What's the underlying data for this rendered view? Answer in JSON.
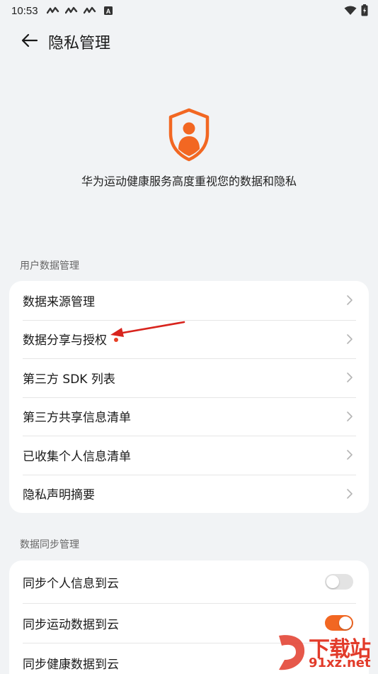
{
  "status_bar": {
    "time": "10:53",
    "icons": [
      "signal-wave-icon",
      "signal-wave-icon",
      "signal-wave-icon",
      "a-badge-icon"
    ],
    "battery_icon": "battery-charging-icon",
    "wifi_icon": "wifi-icon"
  },
  "header": {
    "title": "隐私管理",
    "back_icon": "arrow-left-icon"
  },
  "hero": {
    "icon": "shield-user-icon",
    "text": "华为运动健康服务高度重视您的数据和隐私",
    "accent_color": "#f26722"
  },
  "sections": {
    "user_data": {
      "label": "用户数据管理",
      "items": [
        {
          "label": "数据来源管理"
        },
        {
          "label": "数据分享与授权",
          "badge": "red-dot"
        },
        {
          "label": "第三方 SDK 列表"
        },
        {
          "label": "第三方共享信息清单"
        },
        {
          "label": "已收集个人信息清单"
        },
        {
          "label": "隐私声明摘要"
        }
      ]
    },
    "sync": {
      "label": "数据同步管理",
      "items": [
        {
          "label": "同步个人信息到云",
          "toggle": "off"
        },
        {
          "label": "同步运动数据到云",
          "toggle": "on"
        },
        {
          "label": "同步健康数据到云"
        }
      ]
    }
  },
  "watermark": {
    "logo_text": "下载站",
    "url": "91xz.net"
  }
}
